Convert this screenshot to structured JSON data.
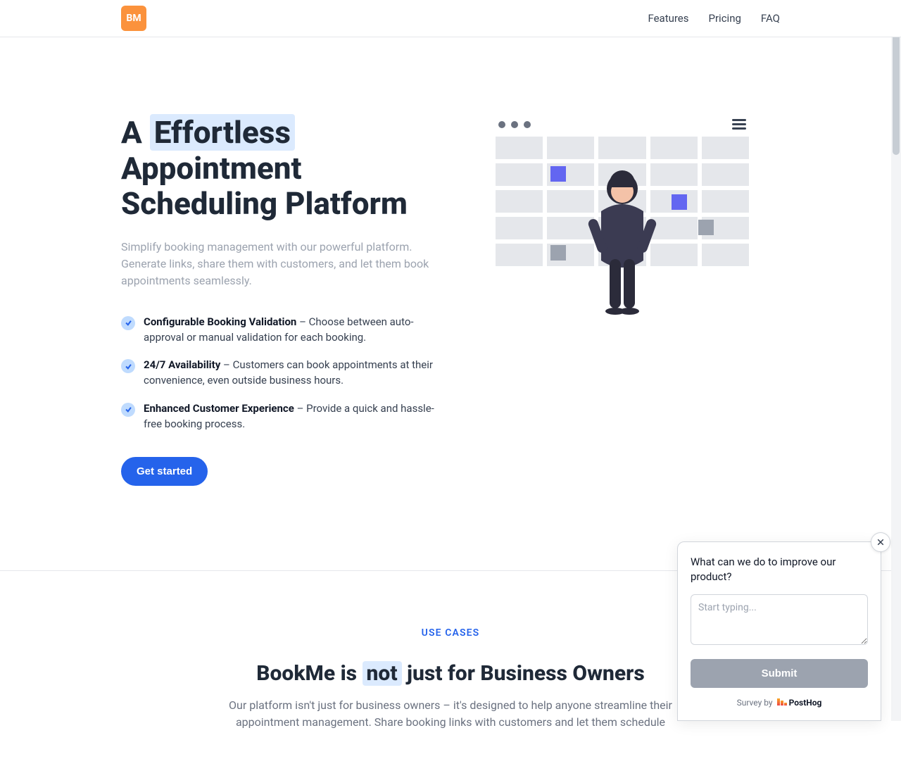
{
  "nav": {
    "logo_text": "BM",
    "links": [
      "Features",
      "Pricing",
      "FAQ"
    ]
  },
  "hero": {
    "h1_prefix": "A ",
    "h1_highlight": "Effortless",
    "h1_rest": " Appointment Scheduling Platform",
    "subtitle": "Simplify booking management with our powerful platform. Generate links, share them with customers, and let them book appointments seamlessly.",
    "bullets": [
      {
        "strong": "Configurable Booking Validation",
        "rest": " – Choose between auto-approval or manual validation for each booking."
      },
      {
        "strong": "24/7 Availability",
        "rest": " – Customers can book appointments at their convenience, even outside business hours."
      },
      {
        "strong": "Enhanced Customer Experience",
        "rest": " – Provide a quick and hassle-free booking process."
      }
    ],
    "cta_label": "Get started"
  },
  "section2": {
    "kicker": "USE CASES",
    "h2_prefix": "BookMe is ",
    "h2_highlight": "not",
    "h2_rest": " just for Business Owners",
    "body": "Our platform isn't just for business owners – it's designed to help anyone streamline their appointment management. Share booking links with customers and let them schedule"
  },
  "survey": {
    "question": "What can we do to improve our product?",
    "placeholder": "Start typing...",
    "submit_label": "Submit",
    "byline_prefix": "Survey by",
    "byline_brand": "PostHog"
  }
}
